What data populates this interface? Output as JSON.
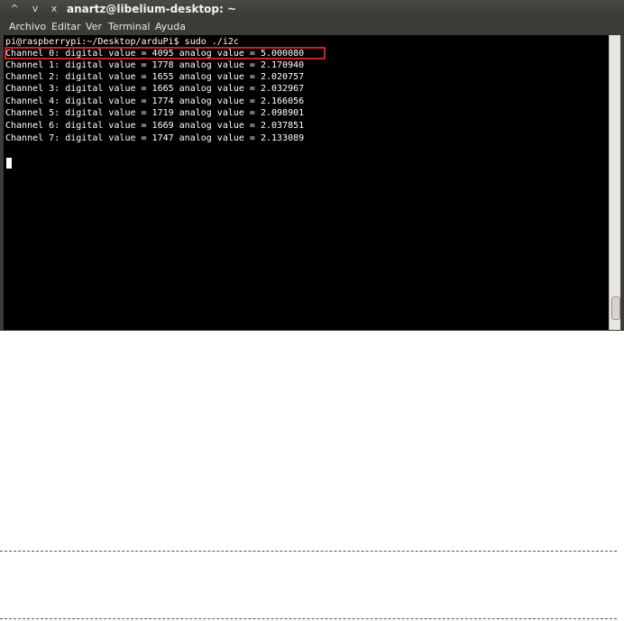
{
  "window": {
    "title": "anartz@libelium-desktop: ~",
    "buttons": [
      "^",
      "v",
      "x"
    ]
  },
  "menubar": {
    "items": [
      "Archivo",
      "Editar",
      "Ver",
      "Terminal",
      "Ayuda"
    ]
  },
  "terminal": {
    "prompt": "pi@raspberrypi:~/Desktop/arduPi$ sudo ./i2c",
    "lines": [
      "Channel 0: digital value = 4095 analog value = 5.000080",
      "Channel 1: digital value = 1778 analog value = 2.170940",
      "Channel 2: digital value = 1655 analog value = 2.020757",
      "Channel 3: digital value = 1665 analog value = 2.032967",
      "Channel 4: digital value = 1774 analog value = 2.166056",
      "Channel 5: digital value = 1719 analog value = 2.098901",
      "Channel 6: digital value = 1669 analog value = 2.037851",
      "Channel 7: digital value = 1747 analog value = 2.133089"
    ]
  },
  "colors": {
    "highlight_border": "#d02020",
    "terminal_bg": "#000000",
    "terminal_fg": "#ffffff"
  }
}
